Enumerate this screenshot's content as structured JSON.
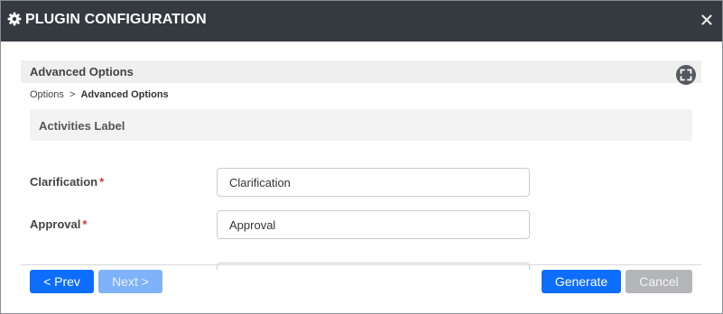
{
  "window": {
    "title": "PLUGIN CONFIGURATION",
    "close_symbol": "×"
  },
  "section": {
    "title": "Advanced Options"
  },
  "breadcrumb": {
    "root": "Options",
    "separator": ">",
    "current": "Advanced Options"
  },
  "group": {
    "title": "Activities Label"
  },
  "fields": [
    {
      "label": "Clarification",
      "required_mark": "*",
      "value": "Clarification"
    },
    {
      "label": "Approval",
      "required_mark": "*",
      "value": "Approval"
    }
  ],
  "buttons": {
    "prev": "< Prev",
    "next": "Next >",
    "generate": "Generate",
    "cancel": "Cancel"
  },
  "colors": {
    "titlebar": "#343a40",
    "primary": "#0d6efd",
    "primary_disabled": "#7fb2f8",
    "cancel": "#b3b5b8",
    "required": "#d9332e"
  },
  "icons": {
    "title": "gear-icon",
    "close": "close-icon",
    "expand": "fullscreen-icon"
  }
}
